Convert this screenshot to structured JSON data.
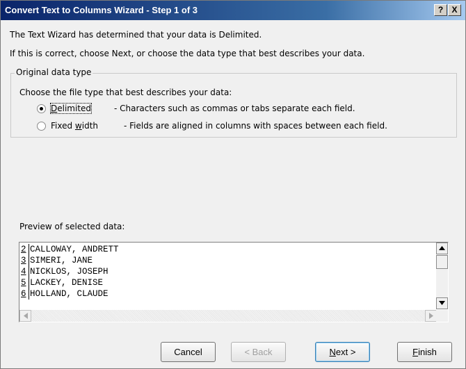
{
  "window": {
    "title": "Convert Text to Columns Wizard - Step 1 of 3",
    "help_label": "?",
    "close_label": "X"
  },
  "intro": {
    "line1": "The Text Wizard has determined that your data is Delimited.",
    "line2": "If this is correct, choose Next, or choose the data type that best describes your data."
  },
  "original_data_type": {
    "legend": "Original data type",
    "instruction": "Choose the file type that best describes your data:",
    "options": [
      {
        "label_pre": "",
        "label_accel": "D",
        "label_post": "elimited",
        "description": "- Characters such as commas or tabs separate each field.",
        "selected": true
      },
      {
        "label_pre": "Fixed ",
        "label_accel": "w",
        "label_post": "idth",
        "description": "- Fields are aligned in columns with spaces between each field.",
        "selected": false
      }
    ]
  },
  "preview": {
    "label": "Preview of selected data:",
    "rows": [
      {
        "num": "2",
        "text": "CALLOWAY, ANDRETT"
      },
      {
        "num": "3",
        "text": "SIMERI, JANE"
      },
      {
        "num": "4",
        "text": "NICKLOS, JOSEPH"
      },
      {
        "num": "5",
        "text": "LACKEY, DENISE"
      },
      {
        "num": "6",
        "text": "HOLLAND, CLAUDE"
      }
    ]
  },
  "buttons": {
    "cancel": "Cancel",
    "back": "< Back",
    "next_accel": "N",
    "next_post": "ext >",
    "finish_accel": "F",
    "finish_post": "inish"
  },
  "icons": {
    "scroll_up": "up-arrow-icon",
    "scroll_down": "down-arrow-icon",
    "scroll_left": "left-arrow-icon",
    "scroll_right": "right-arrow-icon"
  }
}
